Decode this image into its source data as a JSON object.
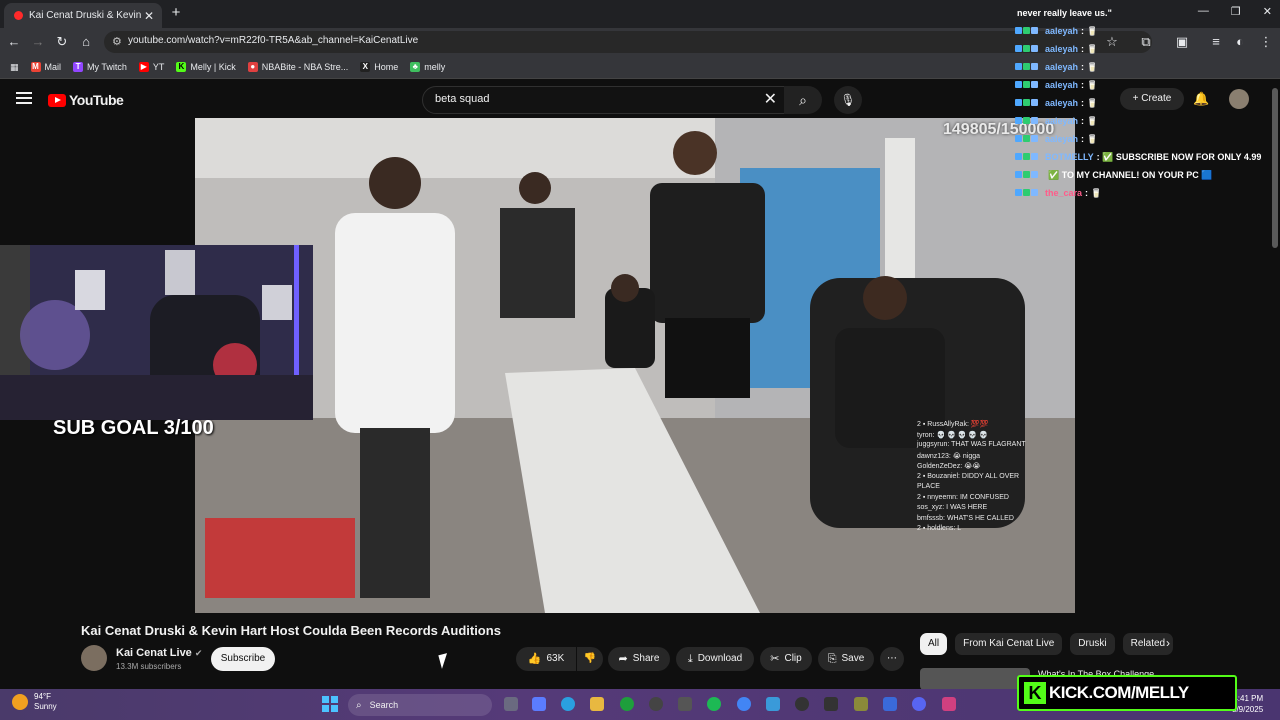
{
  "browser": {
    "tab_title": "Kai Cenat Druski & Kevin H",
    "url": "youtube.com/watch?v=mR22f0-TR5A&ab_channel=KaiCenatLive",
    "bookmarks": [
      {
        "label": "Mail",
        "color": "#ea4335"
      },
      {
        "label": "My Twitch",
        "color": "#9146ff"
      },
      {
        "label": "YT",
        "color": "#ff0000"
      },
      {
        "label": "Melly | Kick",
        "color": "#53fc18"
      },
      {
        "label": "NBABite - NBA Stre...",
        "color": "#e04040"
      },
      {
        "label": "Home",
        "color": "#222222"
      },
      {
        "label": "melly",
        "color": "#3fbf5f"
      }
    ]
  },
  "youtube": {
    "logo": "YouTube",
    "search_query": "beta squad",
    "create_label": "Create",
    "video_title": "Kai Cenat Druski & Kevin Hart Host Coulda Been Records Auditions",
    "channel_name": "Kai Cenat Live",
    "channel_subs": "13.3M subscribers",
    "subscribe_label": "Subscribe",
    "likes": "63K",
    "share_label": "Share",
    "download_label": "Download",
    "clip_label": "Clip",
    "save_label": "Save",
    "chips": [
      "All",
      "From Kai Cenat Live",
      "Druski",
      "Related"
    ],
    "suggested_title": "What's In The Box Challenge"
  },
  "stream": {
    "counter": "149805/150000",
    "sub_goal": "SUB GOAL 3/100",
    "kick_url": "KICK.COM/MELLY"
  },
  "chat": {
    "header_line": "never really leave us.\"",
    "messages": [
      {
        "user": "aaleyah",
        "text": ": 🥛",
        "user_color": "#7fb8ff",
        "text_color": "#ffffff"
      },
      {
        "user": "aaleyah",
        "text": ": 🥛",
        "user_color": "#7fb8ff",
        "text_color": "#ffffff"
      },
      {
        "user": "aaleyah",
        "text": ": 🥛",
        "user_color": "#7fb8ff",
        "text_color": "#ffffff"
      },
      {
        "user": "aaleyah",
        "text": ": 🥛",
        "user_color": "#7fb8ff",
        "text_color": "#ffffff"
      },
      {
        "user": "aaleyah",
        "text": ": 🥛",
        "user_color": "#7fb8ff",
        "text_color": "#ffffff"
      },
      {
        "user": "aaleyah",
        "text": ": 🥛",
        "user_color": "#7fb8ff",
        "text_color": "#ffffff"
      },
      {
        "user": "aaleyah",
        "text": ": 🥛",
        "user_color": "#7fb8ff",
        "text_color": "#ffffff"
      },
      {
        "user": "BOTMELLY",
        "text": ": ✅ SUBSCRIBE NOW FOR ONLY 4.99",
        "user_color": "#7fb8ff",
        "text_color": "#ffffff"
      },
      {
        "user": "",
        "text": "✅ TO MY CHANNEL! ON YOUR PC 🟦",
        "user_color": "#7fb8ff",
        "text_color": "#ffffff"
      },
      {
        "user": "the_cara",
        "text": ": 🥛",
        "user_color": "#ff5c8a",
        "text_color": "#ffffff"
      }
    ],
    "mini": [
      "2 ▪ RussAllyRak: 💯💯",
      "tyron: 💀 💀 💀 💀 💀",
      "juggsyrun: THAT WAS FLAGRANT",
      "dawnz123: 😭 nigga",
      "GoldenZeDez: 😭😭",
      "2 ▪ Bouzaniel: DIDDY ALL OVER",
      "PLACE",
      "2 ▪ nnyeemn: IM CONFUSED",
      "sos_xyz: I WAS HERE",
      "bmfsssb: WHAT'S HE CALLED",
      "2 ▪ holdlens: L"
    ]
  },
  "taskbar": {
    "temp": "94°F",
    "condition": "Sunny",
    "search_label": "Search",
    "time": "4:41 PM",
    "date": "8/9/2025"
  },
  "colors": {
    "yt_red": "#ff0000",
    "kick_green": "#53fc18",
    "bg": "#0f0f0f"
  }
}
